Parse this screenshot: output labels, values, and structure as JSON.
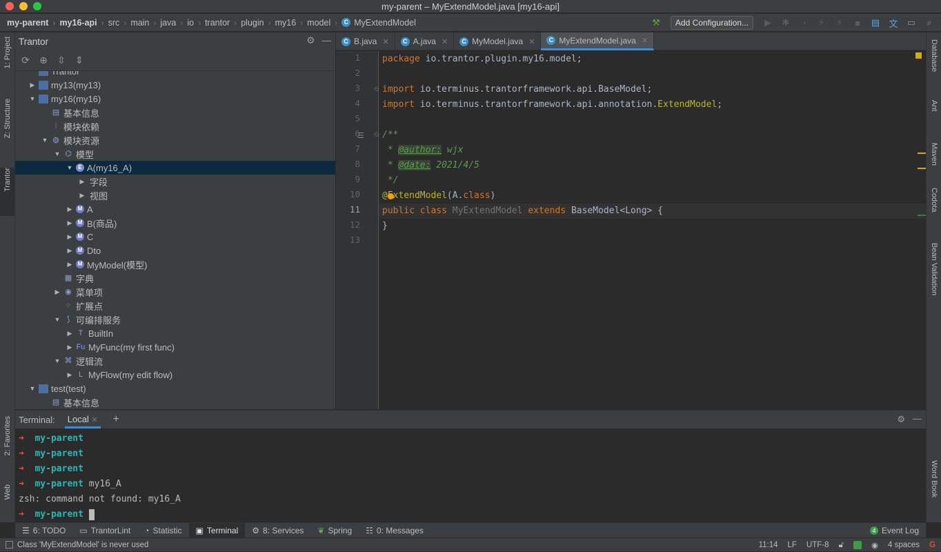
{
  "window": {
    "title": "my-parent – MyExtendModel.java [my16-api]"
  },
  "breadcrumbs": [
    "my-parent",
    "my16-api",
    "src",
    "main",
    "java",
    "io",
    "trantor",
    "plugin",
    "my16",
    "model",
    "MyExtendModel"
  ],
  "toolbar": {
    "add_configuration": "Add Configuration..."
  },
  "left_tabs": [
    "1: Project",
    "Z: Structure",
    "Trantor",
    "2: Favorites",
    "Web"
  ],
  "right_tabs": [
    "Database",
    "Ant",
    "Maven",
    "Codota",
    "Bean Validation",
    "Word Book"
  ],
  "project": {
    "title": "Trantor",
    "tree": [
      {
        "label": "Trantor",
        "depth": 1,
        "arrow": "",
        "icon": "folder"
      },
      {
        "label": "my13(my13)",
        "depth": 1,
        "arrow": "▶",
        "icon": "folder"
      },
      {
        "label": "my16(my16)",
        "depth": 1,
        "arrow": "▼",
        "icon": "folder"
      },
      {
        "label": "基本信息",
        "depth": 2,
        "arrow": "",
        "icon": "info"
      },
      {
        "label": "模块依赖",
        "depth": 2,
        "arrow": "",
        "icon": "dep"
      },
      {
        "label": "模块资源",
        "depth": 2,
        "arrow": "▼",
        "icon": "globe"
      },
      {
        "label": "模型",
        "depth": 3,
        "arrow": "▼",
        "icon": "model"
      },
      {
        "label": "A(my16_A)",
        "depth": 4,
        "arrow": "▼",
        "icon": "E",
        "selected": true
      },
      {
        "label": "字段",
        "depth": 5,
        "arrow": "▶",
        "icon": ""
      },
      {
        "label": "视图",
        "depth": 5,
        "arrow": "▶",
        "icon": ""
      },
      {
        "label": "A",
        "depth": 4,
        "arrow": "▶",
        "icon": "M"
      },
      {
        "label": "B(商品)",
        "depth": 4,
        "arrow": "▶",
        "icon": "M"
      },
      {
        "label": "C",
        "depth": 4,
        "arrow": "▶",
        "icon": "M"
      },
      {
        "label": "Dto",
        "depth": 4,
        "arrow": "▶",
        "icon": "M"
      },
      {
        "label": "MyModel(模型)",
        "depth": 4,
        "arrow": "▶",
        "icon": "M"
      },
      {
        "label": "字典",
        "depth": 3,
        "arrow": "",
        "icon": "dict"
      },
      {
        "label": "菜单项",
        "depth": 3,
        "arrow": "▶",
        "icon": "menu"
      },
      {
        "label": "扩展点",
        "depth": 3,
        "arrow": "",
        "icon": "ext"
      },
      {
        "label": "可编排服务",
        "depth": 3,
        "arrow": "▼",
        "icon": "svc"
      },
      {
        "label": "BuiltIn",
        "depth": 4,
        "arrow": "▶",
        "icon": "T"
      },
      {
        "label": "MyFunc(my first func)",
        "depth": 4,
        "arrow": "▶",
        "icon": "F"
      },
      {
        "label": "逻辑流",
        "depth": 3,
        "arrow": "▼",
        "icon": "flow"
      },
      {
        "label": "MyFlow(my edit flow)",
        "depth": 4,
        "arrow": "▶",
        "icon": "L"
      },
      {
        "label": "test(test)",
        "depth": 1,
        "arrow": "▼",
        "icon": "folder"
      },
      {
        "label": "基本信息",
        "depth": 2,
        "arrow": "",
        "icon": "info"
      }
    ]
  },
  "editor_tabs": [
    {
      "label": "B.java",
      "active": false
    },
    {
      "label": "A.java",
      "active": false
    },
    {
      "label": "MyModel.java",
      "active": false
    },
    {
      "label": "MyExtendModel.java",
      "active": true
    }
  ],
  "code": {
    "line_numbers": [
      "1",
      "2",
      "3",
      "4",
      "5",
      "6",
      "7",
      "8",
      "9",
      "10",
      "11",
      "12",
      "13"
    ],
    "current_line": "11",
    "l1_kw": "package",
    "l1_rest": " io.trantor.plugin.my16.model;",
    "l3_kw": "import",
    "l3_rest": " io.terminus.trantorframework.api.BaseModel;",
    "l4_kw": "import",
    "l4_rest": " io.terminus.trantorframework.api.annotation.",
    "l4_ann": "ExtendModel",
    "l4_end": ";",
    "l6": "/**",
    "l7_pre": " * ",
    "l7_tag": "@author:",
    "l7_val": " wjx",
    "l8_pre": " * ",
    "l8_tag": "@date:",
    "l8_val": " 2021/4/5",
    "l9": " */",
    "l10_ann": "@ExtendModel",
    "l10_open": "(A.",
    "l10_kw": "class",
    "l10_close": ")",
    "l11_kw1": "public class ",
    "l11_name": "MyExtendModel",
    "l11_kw2": " extends ",
    "l11_rest": "BaseModel<Long> {",
    "l12": "}"
  },
  "terminal": {
    "label": "Terminal:",
    "tab": "Local",
    "lines": [
      {
        "dir": "my-parent",
        "cmd": ""
      },
      {
        "dir": "my-parent",
        "cmd": ""
      },
      {
        "dir": "my-parent",
        "cmd": ""
      },
      {
        "dir": "my-parent",
        "cmd": " my16_A"
      }
    ],
    "error": "zsh: command not found: my16_A",
    "prompt_dir": "my-parent",
    "arrow": "➜"
  },
  "bottom_tabs": [
    "6: TODO",
    "TrantorLint",
    "Statistic",
    "Terminal",
    "8: Services",
    "Spring",
    "0: Messages",
    "Event Log"
  ],
  "bottom_event_count": "4",
  "status": {
    "message": "Class 'MyExtendModel' is never used",
    "position": "11:14",
    "line_sep": "LF",
    "encoding": "UTF-8",
    "indent": "4 spaces"
  }
}
